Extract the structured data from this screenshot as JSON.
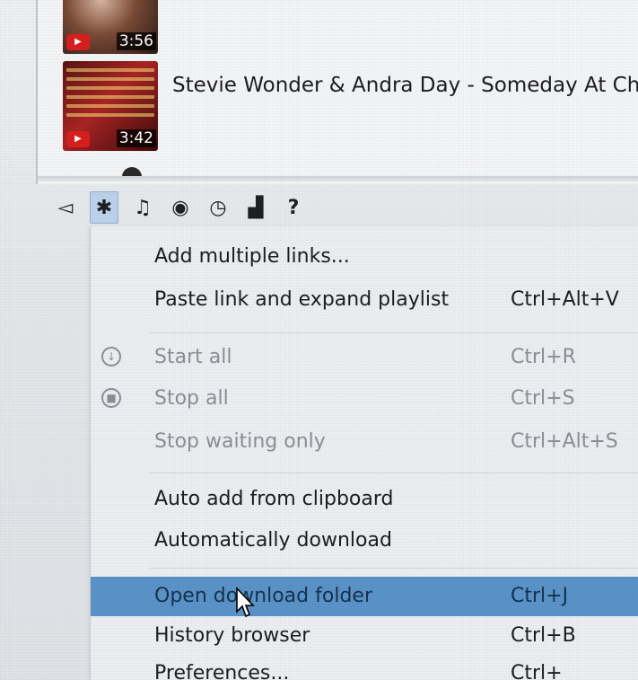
{
  "playlist": {
    "items": [
      {
        "duration": "3:56",
        "title": "",
        "badge": "▶"
      },
      {
        "duration": "3:42",
        "title": "Stevie Wonder & Andra Day - Someday At Christma",
        "badge": "▶"
      }
    ]
  },
  "toolbar": {
    "items": [
      {
        "name": "broom-icon",
        "glyph": "◅"
      },
      {
        "name": "gear-icon",
        "glyph": "✱"
      },
      {
        "name": "music-note-icon",
        "glyph": "♫"
      },
      {
        "name": "snail-icon",
        "glyph": "◉"
      },
      {
        "name": "clock-icon",
        "glyph": "◷"
      },
      {
        "name": "binoculars-icon",
        "glyph": "▟"
      },
      {
        "name": "help-icon",
        "glyph": "?"
      }
    ]
  },
  "menu": {
    "items": [
      {
        "label": "Add multiple links...",
        "shortcut": "",
        "state": "enabled"
      },
      {
        "label": "Paste link and expand playlist",
        "shortcut": "Ctrl+Alt+V",
        "state": "enabled"
      },
      {
        "label": "Start all",
        "shortcut": "Ctrl+R",
        "state": "disabled",
        "icon": "download-circle-icon"
      },
      {
        "label": "Stop all",
        "shortcut": "Ctrl+S",
        "state": "disabled",
        "icon": "stop-circle-icon"
      },
      {
        "label": "Stop waiting only",
        "shortcut": "Ctrl+Alt+S",
        "state": "disabled"
      },
      {
        "label": "Auto add from clipboard",
        "shortcut": "",
        "state": "enabled"
      },
      {
        "label": "Automatically download",
        "shortcut": "",
        "state": "enabled"
      },
      {
        "label": "Open download folder",
        "shortcut": "Ctrl+J",
        "state": "highlighted"
      },
      {
        "label": "History browser",
        "shortcut": "Ctrl+B",
        "state": "enabled"
      },
      {
        "label": "Preferences...",
        "shortcut": "Ctrl+",
        "state": "enabled"
      }
    ]
  },
  "colors": {
    "highlight": "#5a93c8",
    "youtube_red": "#d81f1f"
  }
}
